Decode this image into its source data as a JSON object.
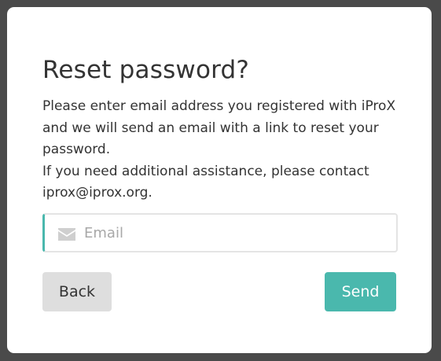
{
  "colors": {
    "accent": "#4ab8ad",
    "back_button_bg": "#dedede",
    "backdrop": "#4a4a4a",
    "placeholder": "#a8a8a8"
  },
  "dialog": {
    "title": "Reset password?",
    "description_line1": "Please enter email address you registered with iProX and we will send an email with a link to reset your password.",
    "description_line2": "If you need additional assistance, please contact iprox@iprox.org."
  },
  "email_field": {
    "icon": "envelope-icon",
    "placeholder": "Email",
    "value": ""
  },
  "buttons": {
    "back_label": "Back",
    "send_label": "Send"
  }
}
